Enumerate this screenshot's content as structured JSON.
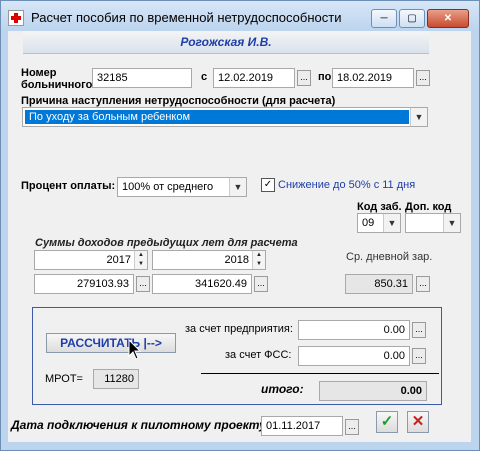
{
  "window": {
    "title": "Расчет пособия по временной нетрудоспособности",
    "min_glyph": "─",
    "max_glyph": "▢",
    "close_glyph": "✕"
  },
  "employee": {
    "name": "Рогожская И.В."
  },
  "sick_leave": {
    "number_label": "Номер больничного",
    "number": "32185",
    "from_label": "с",
    "from": "12.02.2019",
    "to_label": "по",
    "to": "18.02.2019",
    "dots": "..."
  },
  "reason": {
    "label": "Причина наступления нетрудоспособности (для расчета)",
    "value": "По уходу за больным ребенком"
  },
  "payment": {
    "label": "Процент оплаты:",
    "value": "100% от среднего",
    "reduction_checked": true,
    "reduction_label": "Снижение до 50%  с 11 дня"
  },
  "codes": {
    "code_label": "Код заб.",
    "code_value": "09",
    "extra_label": "Доп. код",
    "extra_value": ""
  },
  "income": {
    "title": "Суммы доходов предыдущих лет для расчета",
    "year1": "2017",
    "year2": "2018",
    "amount1": "279103.93",
    "amount2": "341620.49",
    "avg_label": "Ср. дневной зар.",
    "avg_value": "850.31"
  },
  "calc": {
    "button": "РАССЧИТАТЬ |-->",
    "employer_label": "за счет предприятия:",
    "employer_value": "0.00",
    "fss_label": "за счет ФСС:",
    "fss_value": "0.00",
    "mrot_label": "МРОТ=",
    "mrot_value": "11280",
    "total_label": "итого:",
    "total_value": "0.00"
  },
  "pilot": {
    "label": "Дата подключения к пилотному проекту",
    "value": "01.11.2017"
  },
  "actions": {
    "ok": "✓",
    "cancel": "✕"
  }
}
